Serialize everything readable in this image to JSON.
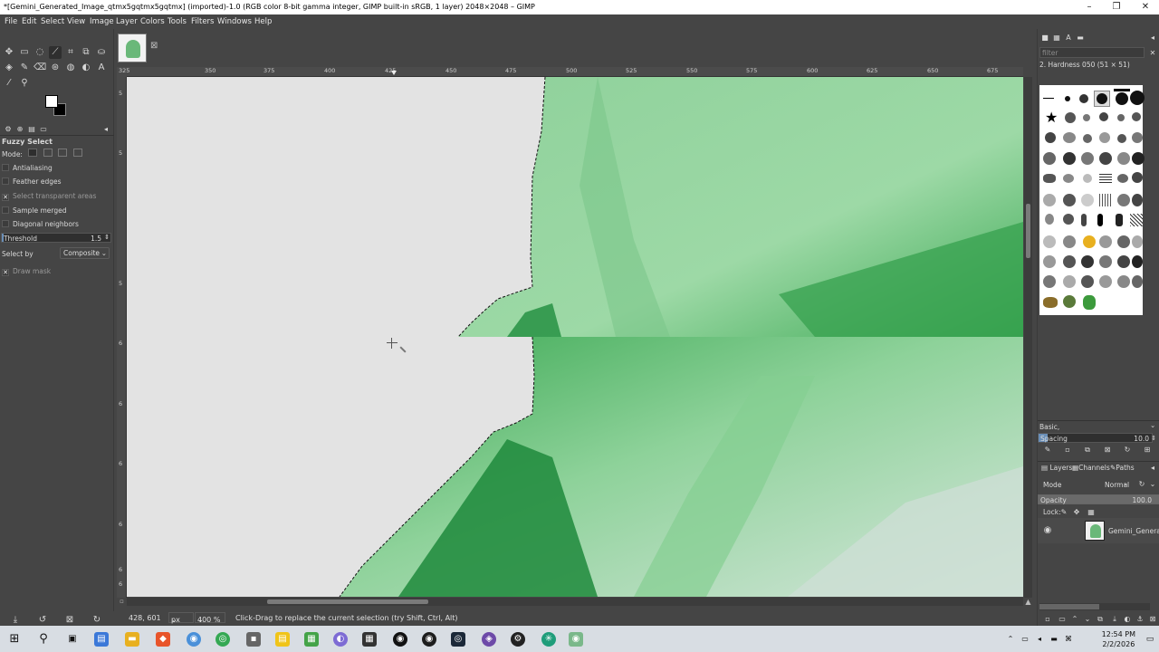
{
  "window": {
    "title": "*[Gemini_Generated_Image_qtmx5gqtmx5gqtmx] (imported)-1.0 (RGB color 8-bit gamma integer, GIMP built-in sRGB, 1 layer) 2048×2048 – GIMP",
    "minimize": "–",
    "maximize": "❐",
    "close": "✕"
  },
  "menu": [
    "File",
    "Edit",
    "Select",
    "View",
    "Image",
    "Layer",
    "Colors",
    "Tools",
    "Filters",
    "Windows",
    "Help"
  ],
  "tool_options": {
    "title": "Fuzzy Select",
    "mode_label": "Mode:",
    "antialiasing": "Antialiasing",
    "feather_edges": "Feather edges",
    "select_transparent": "Select transparent areas",
    "sample_merged": "Sample merged",
    "diagonal_neighbors": "Diagonal neighbors",
    "threshold_label": "Threshold",
    "threshold_value": "1.5",
    "select_by_label": "Select by",
    "select_by_value": "Composite",
    "draw_mask": "Draw mask",
    "check_mark": "✕"
  },
  "ruler": {
    "top": [
      "325",
      "350",
      "375",
      "400",
      "425",
      "450",
      "475",
      "500",
      "525",
      "550",
      "575",
      "600",
      "625",
      "650",
      "675"
    ],
    "left": [
      "5",
      "5",
      "5",
      "6",
      "6",
      "6",
      "6",
      "6",
      "6"
    ]
  },
  "status": {
    "coords": "428, 601",
    "unit": "px",
    "zoom": "400 %",
    "message": "Click-Drag to replace the current selection (try Shift, Ctrl, Alt)"
  },
  "brushes": {
    "filter_placeholder": "filter",
    "selected": "2. Hardness 050 (51 × 51)",
    "preset": "Basic,",
    "spacing_label": "Spacing",
    "spacing_value": "10.0"
  },
  "layers": {
    "tabs": [
      "Layers",
      "Channels",
      "Paths"
    ],
    "mode_label": "Mode",
    "mode_value": "Normal",
    "opacity_label": "Opacity",
    "opacity_value": "100.0",
    "lock_label": "Lock:",
    "layer_name": "Gemini_Generat"
  },
  "taskbar": {
    "time": "12:54 PM",
    "date": "2/2/2026"
  }
}
